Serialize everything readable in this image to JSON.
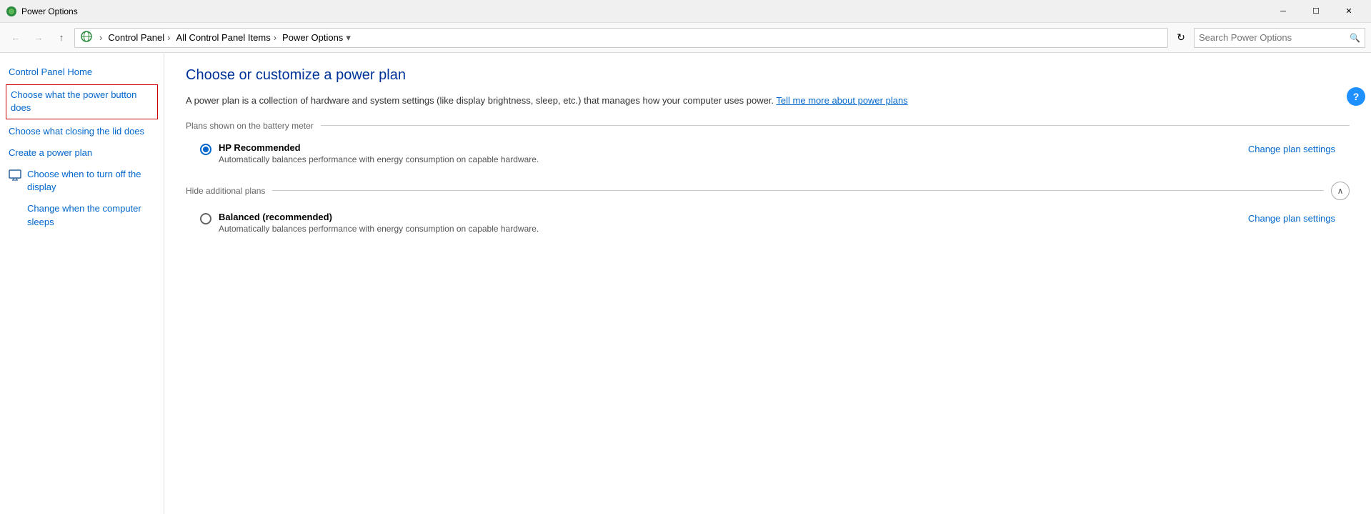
{
  "window": {
    "title": "Power Options",
    "icon": "⚡"
  },
  "titlebar": {
    "minimize_label": "─",
    "maximize_label": "☐",
    "close_label": "✕"
  },
  "addressbar": {
    "back_label": "←",
    "forward_label": "→",
    "up_label": "↑",
    "refresh_label": "↻",
    "dropdown_label": "▾",
    "breadcrumbs": [
      "Control Panel",
      "All Control Panel Items",
      "Power Options"
    ],
    "search_placeholder": "Search Power Options",
    "help_label": "?"
  },
  "sidebar": {
    "items": [
      {
        "id": "control-panel-home",
        "label": "Control Panel Home",
        "icon": null,
        "active": false
      },
      {
        "id": "power-button",
        "label": "Choose what the power button does",
        "icon": null,
        "active": true
      },
      {
        "id": "lid",
        "label": "Choose what closing the lid does",
        "icon": null,
        "active": false
      },
      {
        "id": "create-plan",
        "label": "Create a power plan",
        "icon": null,
        "active": false
      },
      {
        "id": "turn-off-display",
        "label": "Choose when to turn off the display",
        "icon": "monitor",
        "active": false
      },
      {
        "id": "computer-sleeps",
        "label": "Change when the computer sleeps",
        "icon": "moon",
        "active": false
      }
    ]
  },
  "content": {
    "title": "Choose or customize a power plan",
    "description": "A power plan is a collection of hardware and system settings (like display brightness, sleep, etc.) that manages how your computer uses power.",
    "learn_more_link": "Tell me more about power plans",
    "plans_shown_label": "Plans shown on the battery meter",
    "plans": [
      {
        "id": "hp-recommended",
        "name": "HP Recommended",
        "description": "Automatically balances performance with energy consumption on capable hardware.",
        "selected": true,
        "settings_link": "Change plan settings"
      }
    ],
    "hide_plans_label": "Hide additional plans",
    "additional_plans": [
      {
        "id": "balanced",
        "name": "Balanced (recommended)",
        "description": "Automatically balances performance with energy consumption on capable hardware.",
        "selected": false,
        "settings_link": "Change plan settings"
      }
    ]
  }
}
